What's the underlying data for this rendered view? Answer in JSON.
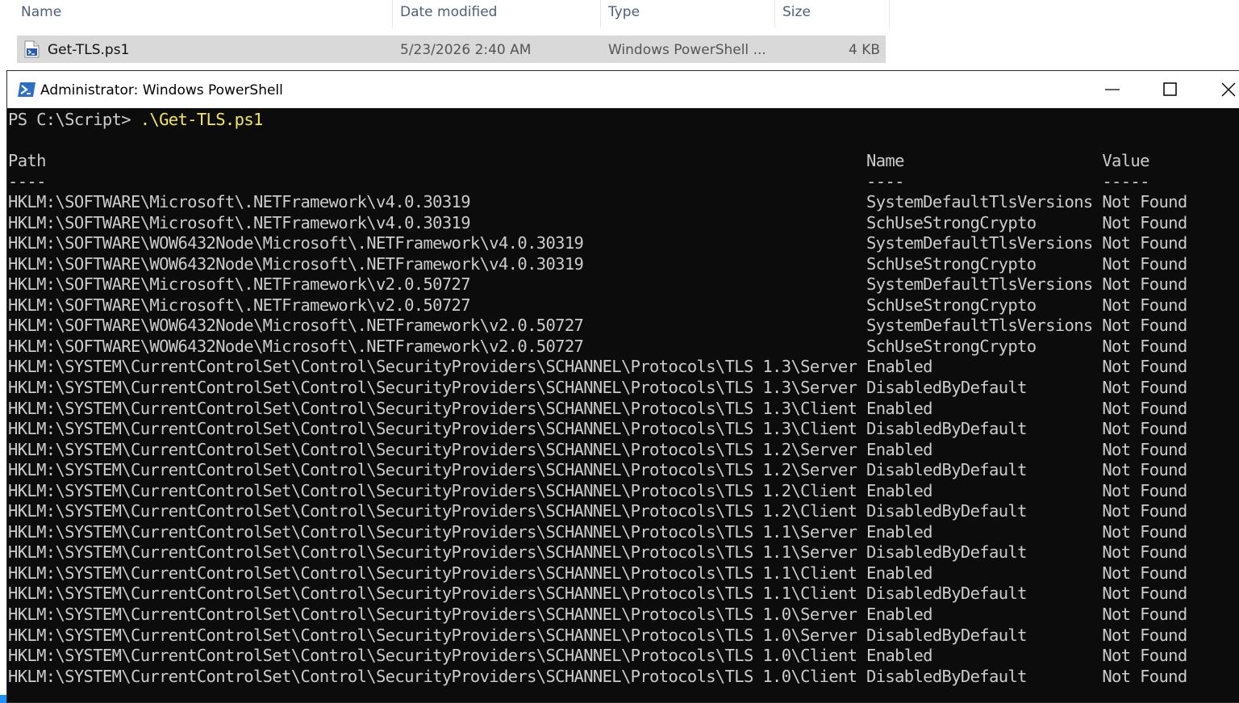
{
  "explorer": {
    "columns": [
      "Name",
      "Date modified",
      "Type",
      "Size"
    ],
    "file": {
      "name": "Get-TLS.ps1",
      "date_modified": "5/23/2026 2:40 AM",
      "type": "Windows PowerShell ...",
      "size": "4 KB",
      "icon": "powershell-script-file-icon"
    }
  },
  "window": {
    "title": "Administrator: Windows PowerShell",
    "icon": "powershell-icon",
    "controls": [
      "minimize",
      "maximize",
      "close"
    ]
  },
  "console": {
    "prompt": "PS C:\\Script> ",
    "command": ".\\Get-TLS.ps1",
    "headers": [
      "Path",
      "Name",
      "Value"
    ],
    "underlines": [
      "----",
      "----",
      "-----"
    ],
    "rows": [
      [
        "HKLM:\\SOFTWARE\\Microsoft\\.NETFramework\\v4.0.30319",
        "SystemDefaultTlsVersions",
        "Not Found"
      ],
      [
        "HKLM:\\SOFTWARE\\Microsoft\\.NETFramework\\v4.0.30319",
        "SchUseStrongCrypto",
        "Not Found"
      ],
      [
        "HKLM:\\SOFTWARE\\WOW6432Node\\Microsoft\\.NETFramework\\v4.0.30319",
        "SystemDefaultTlsVersions",
        "Not Found"
      ],
      [
        "HKLM:\\SOFTWARE\\WOW6432Node\\Microsoft\\.NETFramework\\v4.0.30319",
        "SchUseStrongCrypto",
        "Not Found"
      ],
      [
        "HKLM:\\SOFTWARE\\Microsoft\\.NETFramework\\v2.0.50727",
        "SystemDefaultTlsVersions",
        "Not Found"
      ],
      [
        "HKLM:\\SOFTWARE\\Microsoft\\.NETFramework\\v2.0.50727",
        "SchUseStrongCrypto",
        "Not Found"
      ],
      [
        "HKLM:\\SOFTWARE\\WOW6432Node\\Microsoft\\.NETFramework\\v2.0.50727",
        "SystemDefaultTlsVersions",
        "Not Found"
      ],
      [
        "HKLM:\\SOFTWARE\\WOW6432Node\\Microsoft\\.NETFramework\\v2.0.50727",
        "SchUseStrongCrypto",
        "Not Found"
      ],
      [
        "HKLM:\\SYSTEM\\CurrentControlSet\\Control\\SecurityProviders\\SCHANNEL\\Protocols\\TLS 1.3\\Server",
        "Enabled",
        "Not Found"
      ],
      [
        "HKLM:\\SYSTEM\\CurrentControlSet\\Control\\SecurityProviders\\SCHANNEL\\Protocols\\TLS 1.3\\Server",
        "DisabledByDefault",
        "Not Found"
      ],
      [
        "HKLM:\\SYSTEM\\CurrentControlSet\\Control\\SecurityProviders\\SCHANNEL\\Protocols\\TLS 1.3\\Client",
        "Enabled",
        "Not Found"
      ],
      [
        "HKLM:\\SYSTEM\\CurrentControlSet\\Control\\SecurityProviders\\SCHANNEL\\Protocols\\TLS 1.3\\Client",
        "DisabledByDefault",
        "Not Found"
      ],
      [
        "HKLM:\\SYSTEM\\CurrentControlSet\\Control\\SecurityProviders\\SCHANNEL\\Protocols\\TLS 1.2\\Server",
        "Enabled",
        "Not Found"
      ],
      [
        "HKLM:\\SYSTEM\\CurrentControlSet\\Control\\SecurityProviders\\SCHANNEL\\Protocols\\TLS 1.2\\Server",
        "DisabledByDefault",
        "Not Found"
      ],
      [
        "HKLM:\\SYSTEM\\CurrentControlSet\\Control\\SecurityProviders\\SCHANNEL\\Protocols\\TLS 1.2\\Client",
        "Enabled",
        "Not Found"
      ],
      [
        "HKLM:\\SYSTEM\\CurrentControlSet\\Control\\SecurityProviders\\SCHANNEL\\Protocols\\TLS 1.2\\Client",
        "DisabledByDefault",
        "Not Found"
      ],
      [
        "HKLM:\\SYSTEM\\CurrentControlSet\\Control\\SecurityProviders\\SCHANNEL\\Protocols\\TLS 1.1\\Server",
        "Enabled",
        "Not Found"
      ],
      [
        "HKLM:\\SYSTEM\\CurrentControlSet\\Control\\SecurityProviders\\SCHANNEL\\Protocols\\TLS 1.1\\Server",
        "DisabledByDefault",
        "Not Found"
      ],
      [
        "HKLM:\\SYSTEM\\CurrentControlSet\\Control\\SecurityProviders\\SCHANNEL\\Protocols\\TLS 1.1\\Client",
        "Enabled",
        "Not Found"
      ],
      [
        "HKLM:\\SYSTEM\\CurrentControlSet\\Control\\SecurityProviders\\SCHANNEL\\Protocols\\TLS 1.1\\Client",
        "DisabledByDefault",
        "Not Found"
      ],
      [
        "HKLM:\\SYSTEM\\CurrentControlSet\\Control\\SecurityProviders\\SCHANNEL\\Protocols\\TLS 1.0\\Server",
        "Enabled",
        "Not Found"
      ],
      [
        "HKLM:\\SYSTEM\\CurrentControlSet\\Control\\SecurityProviders\\SCHANNEL\\Protocols\\TLS 1.0\\Server",
        "DisabledByDefault",
        "Not Found"
      ],
      [
        "HKLM:\\SYSTEM\\CurrentControlSet\\Control\\SecurityProviders\\SCHANNEL\\Protocols\\TLS 1.0\\Client",
        "Enabled",
        "Not Found"
      ],
      [
        "HKLM:\\SYSTEM\\CurrentControlSet\\Control\\SecurityProviders\\SCHANNEL\\Protocols\\TLS 1.0\\Client",
        "DisabledByDefault",
        "Not Found"
      ]
    ]
  },
  "colors": {
    "console_bg": "#0c0c0c",
    "console_text": "#cccccc",
    "command_text": "#f1e85b",
    "selected_row": "#d9d9d9"
  }
}
